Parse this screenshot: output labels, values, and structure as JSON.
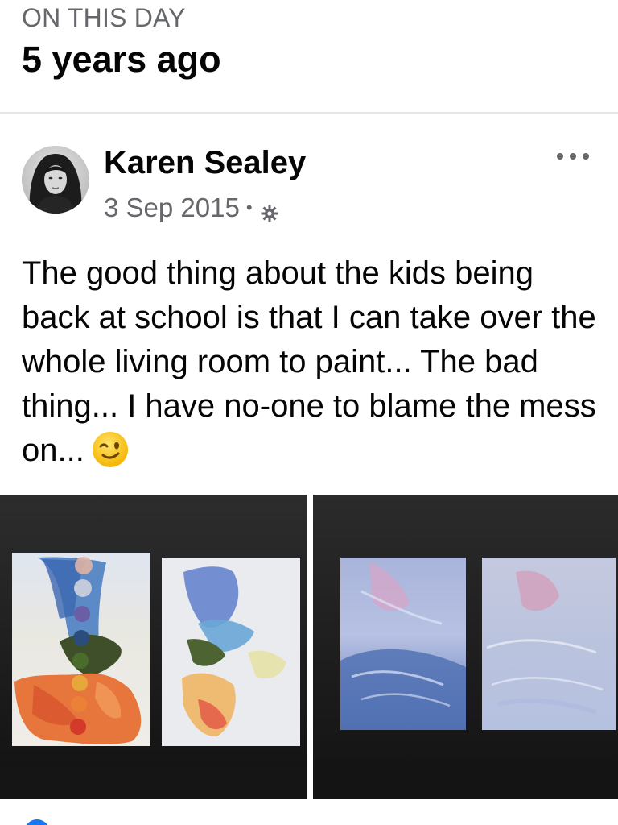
{
  "memory": {
    "kicker": "ON THIS DAY",
    "title": "5 years ago"
  },
  "post": {
    "author": "Karen Sealey",
    "date": "3 Sep 2015",
    "separator": "•",
    "privacy_icon": "gear-icon",
    "more_icon": "more-options-icon",
    "text": "The good thing about the kids being back at school is that I can take over the whole living room to paint... The bad thing... I have no-one to blame the mess on...",
    "emoji": "winking-face-emoji"
  },
  "photos": [
    {
      "description_icon": "chakra-paintings-photo"
    },
    {
      "description_icon": "blue-pink-paintings-photo"
    }
  ],
  "colors": {
    "text_primary": "#050505",
    "text_secondary": "#65676b",
    "divider": "#e4e6eb",
    "accent": "#1877f2"
  }
}
